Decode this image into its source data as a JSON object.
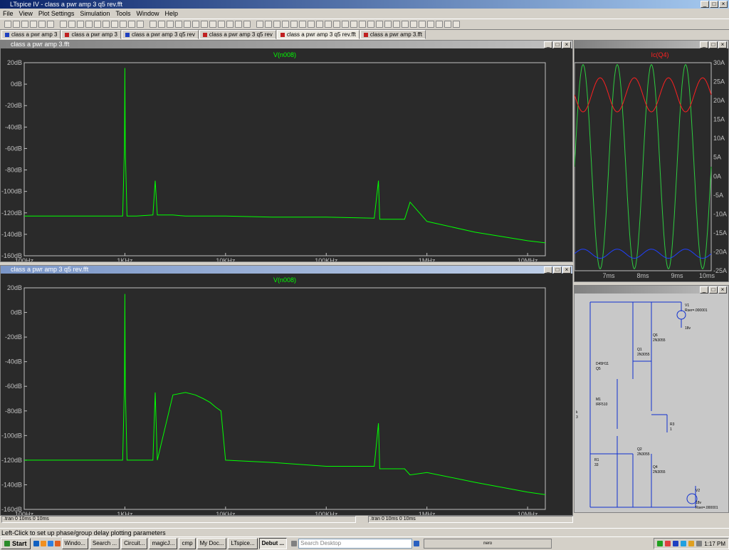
{
  "app": {
    "title": "LTspice IV - class a pwr amp 3 q5 rev.fft"
  },
  "menu": [
    "File",
    "View",
    "Plot Settings",
    "Simulation",
    "Tools",
    "Window",
    "Help"
  ],
  "tabs": [
    {
      "label": "class a pwr amp 3",
      "icon": "schematic-icon",
      "active": false
    },
    {
      "label": "class a pwr amp 3",
      "icon": "waveform-icon",
      "active": false
    },
    {
      "label": "class a pwr amp 3 q5 rev",
      "icon": "schematic-icon",
      "active": false
    },
    {
      "label": "class a pwr amp 3 q5 rev",
      "icon": "waveform-icon",
      "active": false
    },
    {
      "label": "class a pwr amp 3 q5 rev.fft",
      "icon": "waveform-icon",
      "active": true
    },
    {
      "label": "class a pwr amp 3.fft",
      "icon": "waveform-icon",
      "active": false
    }
  ],
  "windows": {
    "fft_top": {
      "title": "class a pwr amp 3.fft",
      "trace": "V(n008)"
    },
    "fft_bottom": {
      "title": "class a pwr amp 3 q5 rev.fft",
      "trace": "V(n008)"
    },
    "waveform": {
      "trace": "Ic(Q4)"
    }
  },
  "axes": {
    "db_ticks": [
      "20dB",
      "0dB",
      "-20dB",
      "-40dB",
      "-60dB",
      "-80dB",
      "-100dB",
      "-120dB",
      "-140dB",
      "-160dB"
    ],
    "freq_ticks": [
      "100Hz",
      "1KHz",
      "10KHz",
      "100KHz",
      "1MHz",
      "10MHz"
    ],
    "time_ticks": [
      "7ms",
      "8ms",
      "9ms",
      "10ms"
    ],
    "current_ticks": [
      "30A",
      "25A",
      "20A",
      "15A",
      "10A",
      "5A",
      "0A",
      "-5A",
      "-10A",
      "-15A",
      "-20A",
      "-25A"
    ]
  },
  "schematic": {
    "labels": [
      "V1",
      "Rser=.000001",
      "18v",
      "Q6",
      "2N3055",
      "Q1",
      "2N3055",
      "D45H11",
      "Q5",
      "M1",
      "IRF510",
      "R3",
      "1",
      "R1",
      "33",
      "Q2",
      "2N3055",
      "Q4",
      "2N3055",
      "V2",
      "18v",
      "Rser=.000001",
      "k",
      "3"
    ]
  },
  "panes": {
    "top": ".tran 0 10ms 0 10ms",
    "bottom": ".tran 0 10ms 0 10ms"
  },
  "status": "Left-Click to set up phase/group delay plotting parameters",
  "taskbar": {
    "start": "Start",
    "buttons": [
      {
        "label": "Windo..."
      },
      {
        "label": "Search ..."
      },
      {
        "label": "Circuit..."
      },
      {
        "label": "magicJ..."
      },
      {
        "label": "cmp"
      },
      {
        "label": "My Doc..."
      },
      {
        "label": "LTspice..."
      },
      {
        "label": "Debut ...",
        "pressed": true
      }
    ],
    "search_placeholder": "Search Desktop",
    "tray_brand": "nero",
    "clock": "1:17 PM"
  },
  "chart_data": [
    {
      "type": "line",
      "title": "V(n008)",
      "xscale": "log",
      "xlim": [
        100,
        15000000
      ],
      "ylim": [
        -160,
        20
      ],
      "series": [
        {
          "name": "V(n008)",
          "color": "#00ff00",
          "x": [
            100,
            700,
            950,
            990,
            1000,
            1010,
            1050,
            1300,
            1900,
            2000,
            2100,
            3000,
            4000,
            5000,
            10000,
            30000,
            100000,
            300000,
            330000,
            340000,
            600000,
            680000,
            1000000,
            3000000,
            10000000,
            15000000
          ],
          "y": [
            -123,
            -123,
            -123,
            -60,
            15,
            -60,
            -123,
            -123,
            -122,
            -90,
            -122,
            -122,
            -123,
            -123,
            -123,
            -124,
            -124,
            -125,
            -90,
            -126,
            -126,
            -110,
            -128,
            -138,
            -146,
            -148
          ]
        }
      ]
    },
    {
      "type": "line",
      "title": "V(n008)",
      "xscale": "log",
      "xlim": [
        100,
        15000000
      ],
      "ylim": [
        -160,
        20
      ],
      "series": [
        {
          "name": "V(n008)",
          "color": "#00ff00",
          "x": [
            100,
            700,
            950,
            990,
            1000,
            1010,
            1050,
            1300,
            1900,
            2000,
            2100,
            3000,
            4000,
            5000,
            6000,
            7000,
            8000,
            9000,
            10000,
            30000,
            100000,
            300000,
            330000,
            340000,
            600000,
            680000,
            1000000,
            3000000,
            10000000,
            15000000
          ],
          "y": [
            -120,
            -120,
            -120,
            -60,
            15,
            -60,
            -120,
            -120,
            -120,
            -65,
            -120,
            -67,
            -65,
            -67,
            -70,
            -73,
            -77,
            -80,
            -120,
            -122,
            -125,
            -125,
            -90,
            -127,
            -127,
            -132,
            -130,
            -138,
            -146,
            -148
          ]
        }
      ]
    },
    {
      "type": "line",
      "title": "Ic(Q4)",
      "xlim": [
        6.0,
        10.0
      ],
      "ylim": [
        -25,
        30
      ],
      "series": [
        {
          "name": "green",
          "color": "#2ecc40",
          "kind": "sine",
          "offset": 2.5,
          "amp": 27,
          "periods_per_ms": 1,
          "phase": 0
        },
        {
          "name": "red",
          "color": "#ff2020",
          "kind": "sine",
          "offset": 21.5,
          "amp": 4.5,
          "periods_per_ms": 1,
          "phase": 0.5
        },
        {
          "name": "blue",
          "color": "#2040ff",
          "kind": "sine",
          "offset": -20.5,
          "amp": 1.2,
          "periods_per_ms": 1,
          "phase": 0
        }
      ]
    }
  ]
}
